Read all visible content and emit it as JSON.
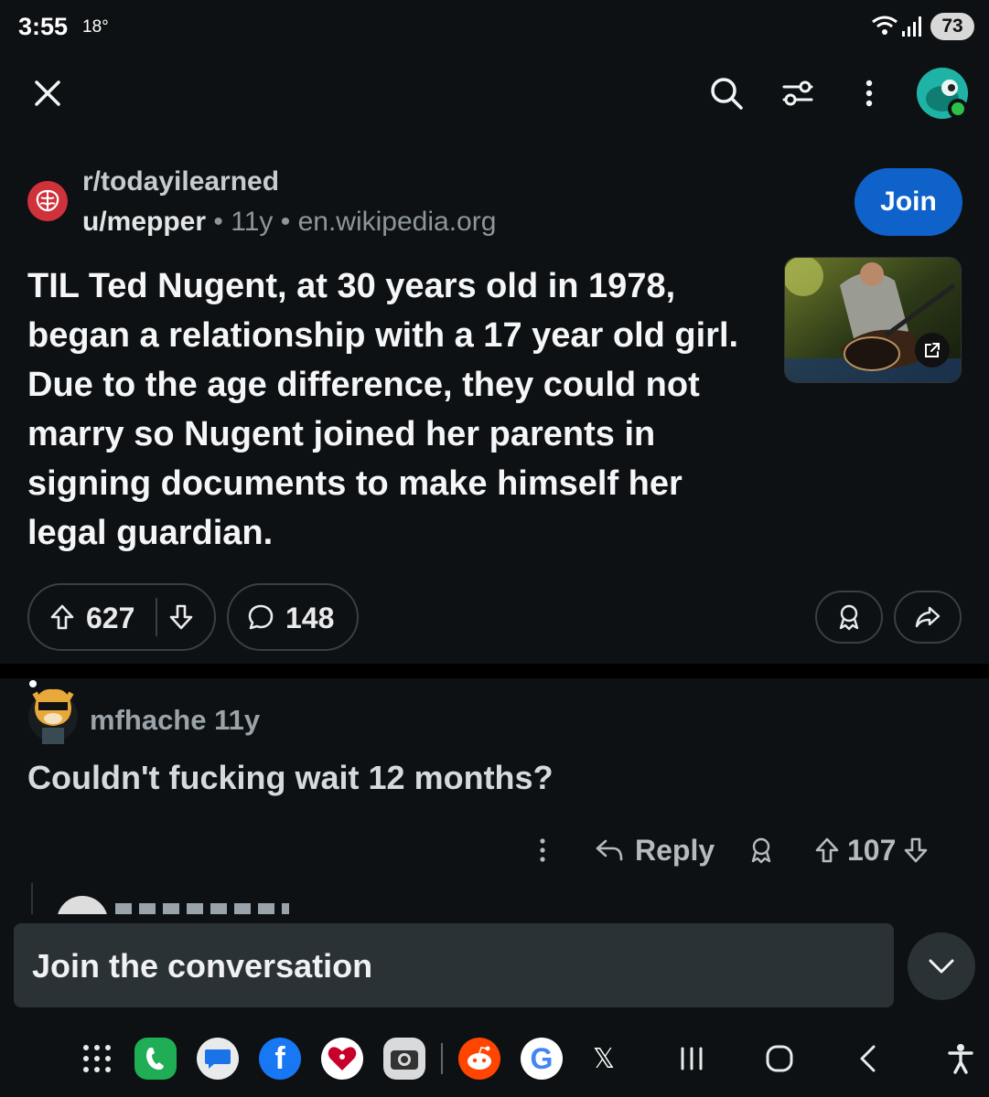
{
  "status_bar": {
    "time": "3:55",
    "temperature": "18°",
    "network": "6E",
    "battery": "73"
  },
  "top_bar": {
    "icons": [
      "close-icon",
      "search-icon",
      "filter-icon",
      "more-vertical-icon",
      "avatar"
    ]
  },
  "post": {
    "subreddit": "r/todayilearned",
    "author": "u/mepper",
    "age": "11y",
    "domain": "en.wikipedia.org",
    "separator": "•",
    "join_label": "Join",
    "title": "TIL Ted Nugent, at 30 years old in 1978, began a relationship with a 17 year old girl. Due to the age difference, they could not marry so Nugent joined her parents in signing documents to make himself her legal guardian.",
    "upvotes": "627",
    "comments": "148"
  },
  "comment": {
    "author": "mfhache",
    "age": "11y",
    "body": "Couldn't fucking wait 12 months?",
    "reply_label": "Reply",
    "votes": "107"
  },
  "composer": {
    "placeholder": "Join the conversation"
  },
  "colors": {
    "background": "#0e1113",
    "join_button": "#0f62c9",
    "subreddit_icon": "#d0323b",
    "composer_bg": "#2a3236",
    "online_dot": "#2ec14a"
  }
}
